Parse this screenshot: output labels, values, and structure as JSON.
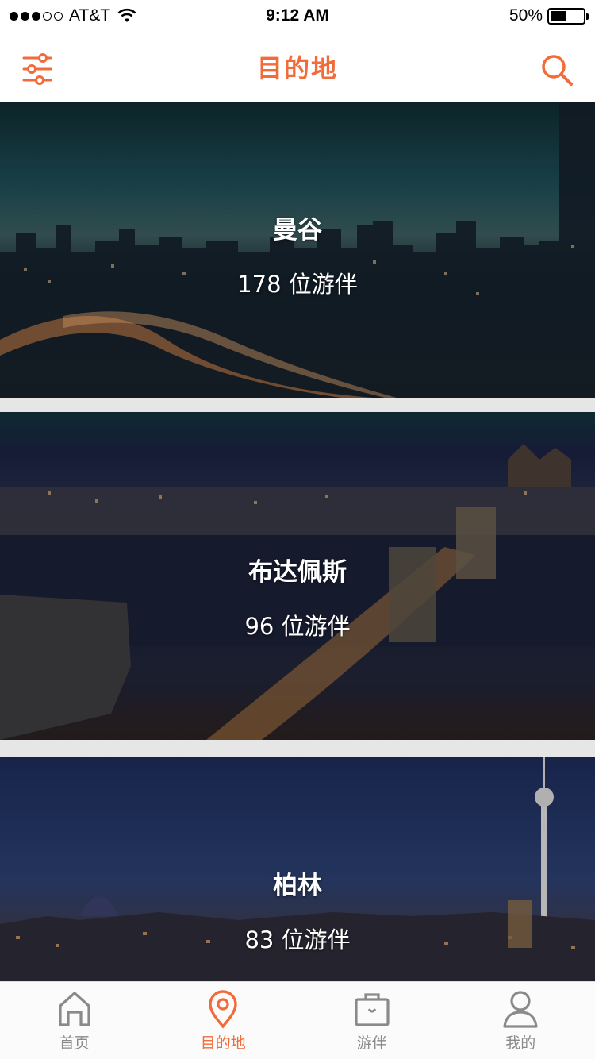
{
  "status_bar": {
    "carrier": "AT&T",
    "time": "9:12 AM",
    "battery_percent": "50%",
    "battery_level": 0.5
  },
  "nav": {
    "title": "目的地",
    "left_icon": "filter-sliders-icon",
    "right_icon": "search-icon"
  },
  "destinations": [
    {
      "name": "曼谷",
      "count": "178 位游伴"
    },
    {
      "name": "布达佩斯",
      "count": "96 位游伴"
    },
    {
      "name": "柏林",
      "count": "83 位游伴"
    }
  ],
  "tabs": [
    {
      "label": "首页",
      "icon": "home-icon",
      "active": false
    },
    {
      "label": "目的地",
      "icon": "location-pin-icon",
      "active": true
    },
    {
      "label": "游伴",
      "icon": "briefcase-icon",
      "active": false
    },
    {
      "label": "我的",
      "icon": "user-icon",
      "active": false
    }
  ],
  "colors": {
    "accent": "#f26b3a",
    "tab_inactive": "#8a8a8a",
    "separator": "#e6e6e6"
  }
}
